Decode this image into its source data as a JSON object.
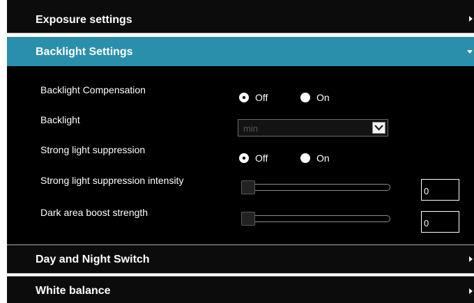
{
  "sections": {
    "exposure": {
      "title": "Exposure settings"
    },
    "backlight": {
      "title": "Backlight Settings",
      "rows": {
        "blc": {
          "label": "Backlight Compensation",
          "options": [
            "Off",
            "On"
          ],
          "selected": "Off"
        },
        "backlight": {
          "label": "Backlight",
          "select_value": "min"
        },
        "strong_light": {
          "label": "Strong light suppression",
          "options": [
            "Off",
            "On"
          ],
          "selected": "Off"
        },
        "strong_light_intensity": {
          "label": "Strong light suppression intensity",
          "value": "0"
        },
        "dark_area": {
          "label": "Dark area boost strength",
          "value": "0"
        }
      }
    },
    "day_night": {
      "title": "Day and Night Switch"
    },
    "white_balance": {
      "title": "White balance"
    }
  },
  "colors": {
    "active_header": "#2a8fab",
    "panel_background": "#000000",
    "text": "#ffffff"
  },
  "icons": {
    "collapsed": "chevron-right-icon",
    "expanded": "chevron-down-icon",
    "select": "dropdown-arrow-icon"
  }
}
